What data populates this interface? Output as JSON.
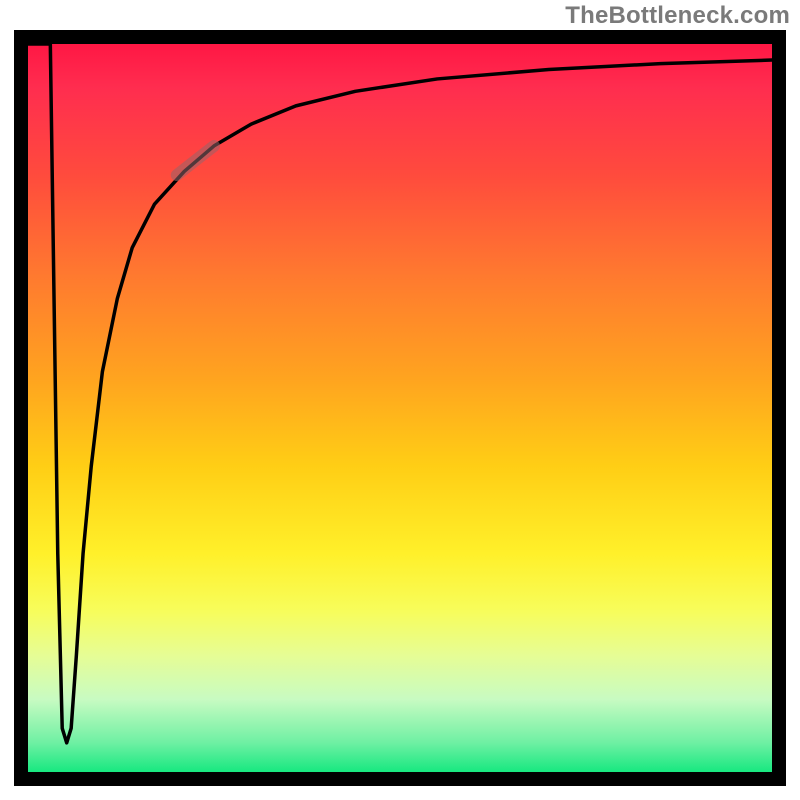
{
  "attribution": "TheBottleneck.com",
  "chart_data": {
    "type": "line",
    "title": "",
    "xlabel": "",
    "ylabel": "",
    "xlim": [
      0,
      100
    ],
    "ylim": [
      0,
      100
    ],
    "grid": false,
    "legend": false,
    "series": [
      {
        "name": "bottleneck-curve",
        "x": [
          0.0,
          3.0,
          4.0,
          4.6,
          5.2,
          5.8,
          6.5,
          7.4,
          8.5,
          10,
          12,
          14,
          17,
          21,
          25,
          30,
          36,
          44,
          55,
          70,
          85,
          100
        ],
        "y": [
          100,
          100,
          30,
          6,
          4,
          6,
          16,
          30,
          42,
          55,
          65,
          72,
          78,
          82.5,
          86,
          89,
          91.5,
          93.5,
          95.2,
          96.5,
          97.3,
          97.8
        ]
      }
    ],
    "annotations": [
      {
        "type": "highlight-segment",
        "series": "bottleneck-curve",
        "x_start": 20,
        "x_end": 25,
        "y_start": 82,
        "y_end": 86,
        "color": "rgba(150,100,105,0.55)"
      }
    ],
    "background": {
      "type": "vertical-gradient",
      "stops": [
        {
          "pos": 0.0,
          "color": "#ff1744"
        },
        {
          "pos": 0.18,
          "color": "#ff4b3d"
        },
        {
          "pos": 0.46,
          "color": "#ffce15"
        },
        {
          "pos": 0.7,
          "color": "#fff02a"
        },
        {
          "pos": 0.9,
          "color": "#c8fbc2"
        },
        {
          "pos": 1.0,
          "color": "#17e880"
        }
      ]
    }
  }
}
